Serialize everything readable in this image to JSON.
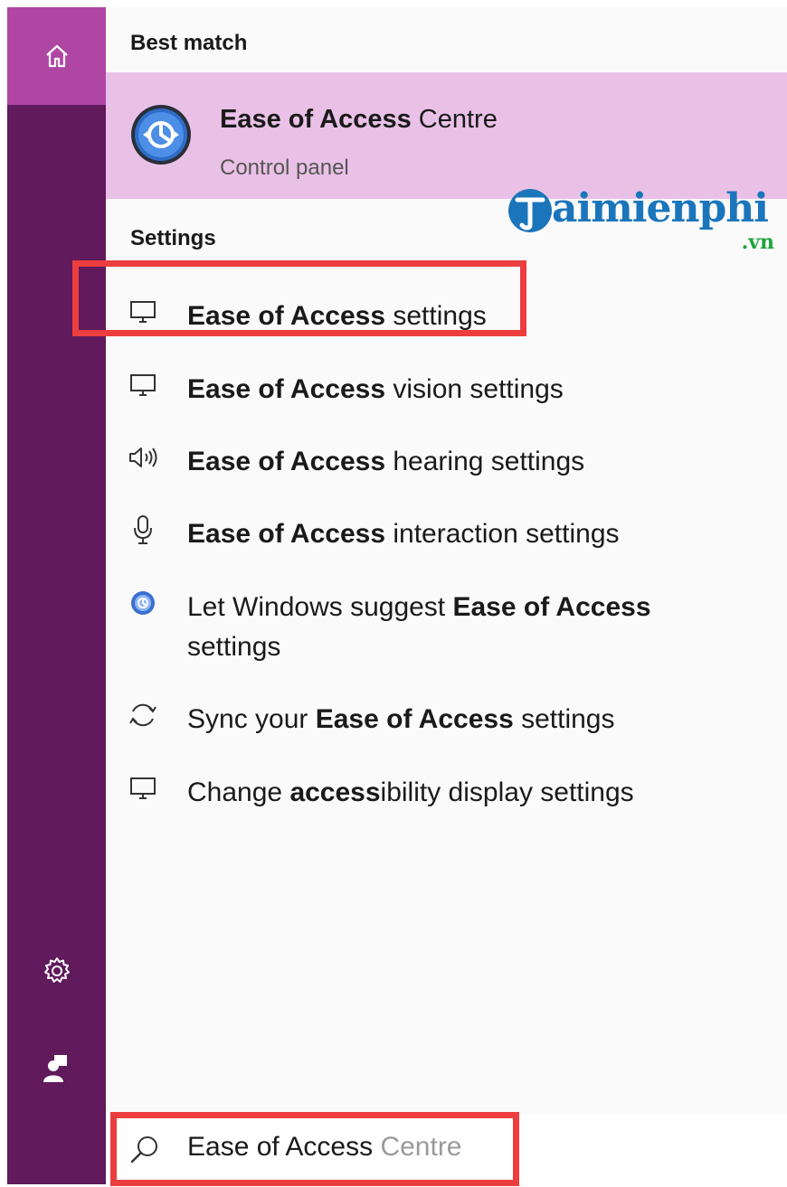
{
  "best_match": {
    "header": "Best match",
    "title_bold": "Ease of Access",
    "title_rest": " Centre",
    "subtitle": "Control panel"
  },
  "watermark": {
    "text": "aimienphi",
    "suffix": ".vn"
  },
  "settings": {
    "header": "Settings",
    "items": [
      {
        "pre": "",
        "bold": "Ease of Access",
        "post": " settings",
        "post2": "",
        "icon": "monitor-icon"
      },
      {
        "pre": "",
        "bold": "Ease of Access",
        "post": " vision settings",
        "post2": "",
        "icon": "monitor-icon"
      },
      {
        "pre": "",
        "bold": "Ease of Access",
        "post": " hearing settings",
        "post2": "",
        "icon": "speaker-icon"
      },
      {
        "pre": "",
        "bold": "Ease of Access",
        "post": " interaction settings",
        "post2": "",
        "icon": "microphone-icon"
      },
      {
        "pre": "Let Windows suggest ",
        "bold": "Ease of Access",
        "post": "",
        "post2": "settings",
        "icon": "ease-of-access-icon"
      },
      {
        "pre": "Sync your ",
        "bold": "Ease of Access",
        "post": " settings",
        "post2": "",
        "icon": "sync-icon"
      },
      {
        "pre": "Change ",
        "bold": "access",
        "post": "ibility display settings",
        "post2": "",
        "icon": "monitor-icon"
      }
    ]
  },
  "search": {
    "typed": "Ease of Access",
    "suggestion": " Centre"
  },
  "colors": {
    "rail": "#611a5b",
    "rail_home": "#b046a4",
    "highlight": "#eac1e6",
    "annotation": "#ec3d3f"
  }
}
